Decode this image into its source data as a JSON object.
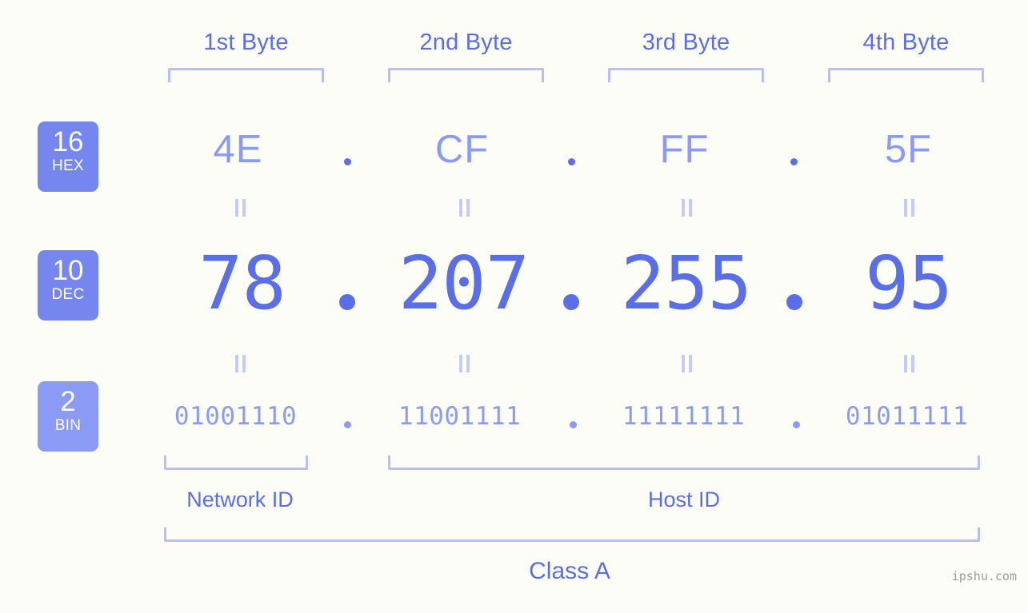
{
  "page": {
    "background_color": "#fdfdf8",
    "accent_color": "#5a6ee8",
    "accent_light_color": "#8b9bf5",
    "bracket_color": "#b6bffa",
    "watermark": "ipshu.com"
  },
  "byte_headers": [
    {
      "label": "1st Byte"
    },
    {
      "label": "2nd Byte"
    },
    {
      "label": "3rd Byte"
    },
    {
      "label": "4th Byte"
    }
  ],
  "bases": [
    {
      "number": "16",
      "name": "HEX",
      "badge_color": "#7586ee"
    },
    {
      "number": "10",
      "name": "DEC",
      "badge_color": "#7586ee"
    },
    {
      "number": "2",
      "name": "BIN",
      "badge_color": "#8b9bf5"
    }
  ],
  "rows": {
    "hex": {
      "octets": [
        "4E",
        "CF",
        "FF",
        "5F"
      ],
      "separator": "."
    },
    "dec": {
      "octets": [
        "78",
        "207",
        "255",
        "95"
      ],
      "separator": "."
    },
    "bin": {
      "octets": [
        "01001110",
        "11001111",
        "11111111",
        "01011111"
      ],
      "separator": "."
    }
  },
  "equals_marks": {
    "glyph": "="
  },
  "zones": [
    {
      "label": "Network ID"
    },
    {
      "label": "Host ID"
    }
  ],
  "address_class": {
    "label": "Class A"
  }
}
